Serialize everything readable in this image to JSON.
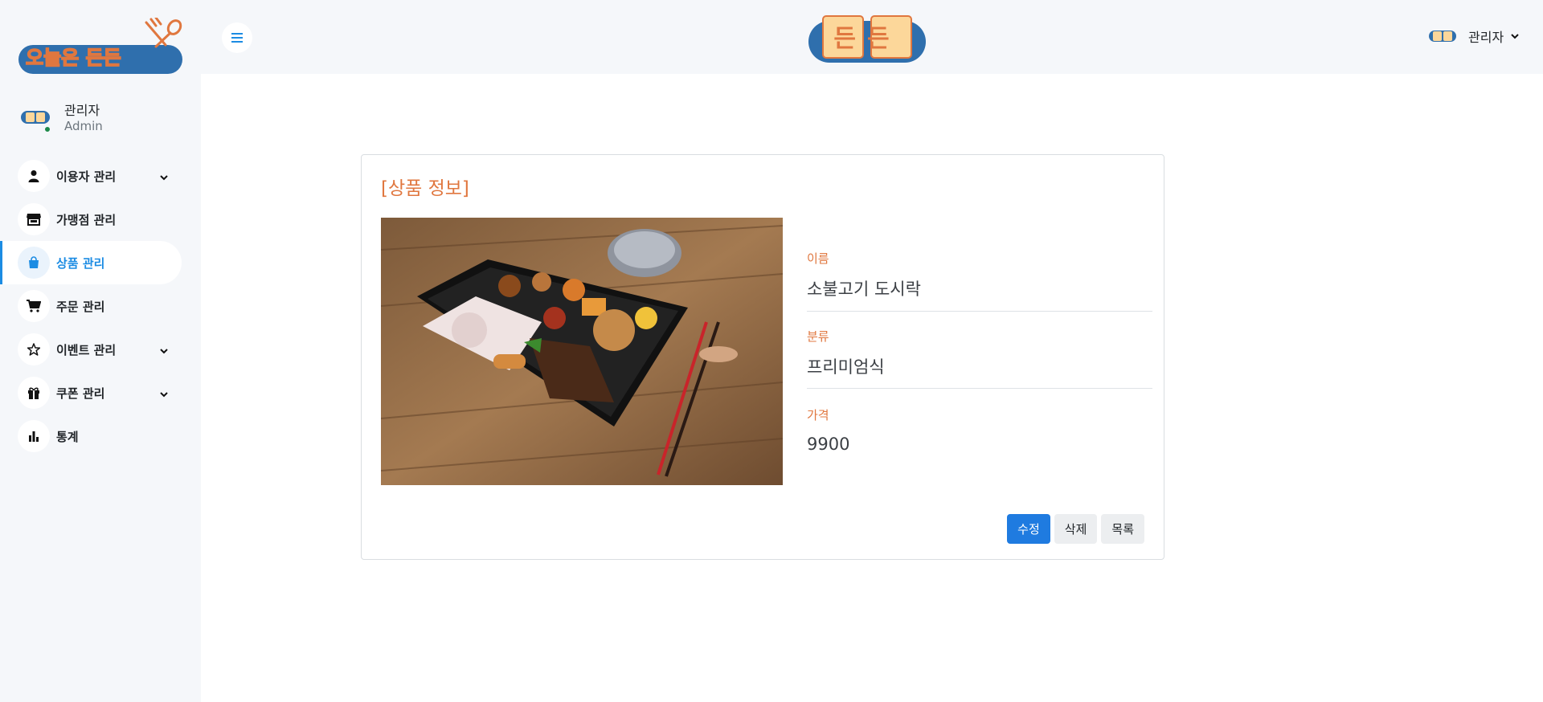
{
  "app": {
    "brand_logo_text": "오늘은 든든",
    "center_logo_text": "든든",
    "mini_logo_text": "든든"
  },
  "sidebar": {
    "user": {
      "name": "관리자",
      "role": "Admin"
    },
    "items": [
      {
        "label": "이용자 관리",
        "icon": "user-icon",
        "has_submenu": true,
        "active": false
      },
      {
        "label": "가맹점 관리",
        "icon": "store-icon",
        "has_submenu": false,
        "active": false
      },
      {
        "label": "상품 관리",
        "icon": "shopping-bag-icon",
        "has_submenu": false,
        "active": true
      },
      {
        "label": "주문 관리",
        "icon": "cart-icon",
        "has_submenu": false,
        "active": false
      },
      {
        "label": "이벤트 관리",
        "icon": "star-icon",
        "has_submenu": true,
        "active": false
      },
      {
        "label": "쿠폰 관리",
        "icon": "gift-icon",
        "has_submenu": true,
        "active": false
      },
      {
        "label": "통계",
        "icon": "bar-chart-icon",
        "has_submenu": false,
        "active": false
      }
    ]
  },
  "header": {
    "menu_toggle_icon": "hamburger-icon",
    "user_name": "관리자"
  },
  "product": {
    "title": "[상품 정보]",
    "fields": [
      {
        "label": "이름",
        "value": "소불고기 도시락"
      },
      {
        "label": "분류",
        "value": "프리미엄식"
      },
      {
        "label": "가격",
        "value": "9900"
      }
    ],
    "buttons": {
      "edit": "수정",
      "delete": "삭제",
      "list": "목록"
    }
  },
  "colors": {
    "accent_blue": "#1c8ce3",
    "primary_button": "#1f7be0",
    "title_orange": "#e0773f",
    "sidebar_bg": "#f5f7fa",
    "online_status": "#1e8a4a"
  }
}
